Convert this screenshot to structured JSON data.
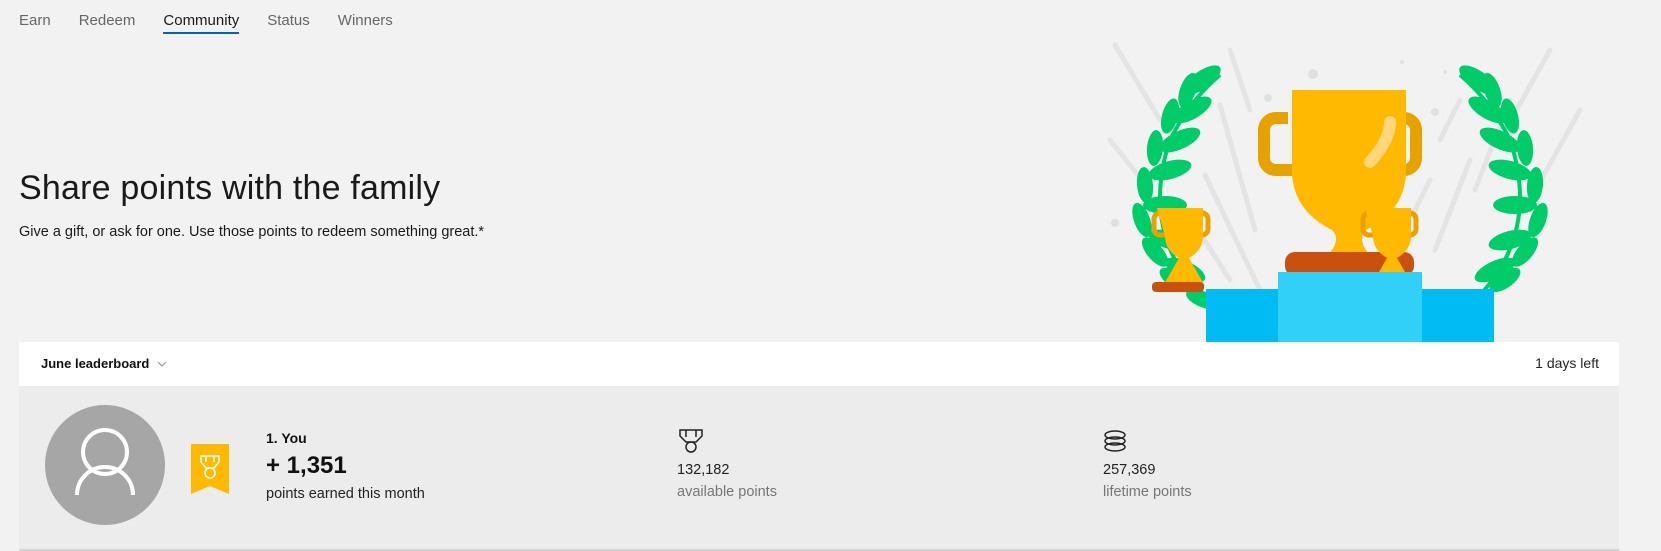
{
  "nav": {
    "tabs": [
      {
        "label": "Earn",
        "active": false
      },
      {
        "label": "Redeem",
        "active": false
      },
      {
        "label": "Community",
        "active": true
      },
      {
        "label": "Status",
        "active": false
      },
      {
        "label": "Winners",
        "active": false
      }
    ]
  },
  "hero": {
    "title": "Share points with the family",
    "subtitle": "Give a gift, or ask for one. Use those points to redeem something great.*",
    "illustration": "trophies-on-podium-with-laurels"
  },
  "leaderboard": {
    "selector_label": "June leaderboard",
    "selector_icon": "chevron-down-icon",
    "days_left": "1 days left",
    "entry": {
      "avatar_icon": "person-icon",
      "badge_icon": "medal-ribbon-icon",
      "rank_label": "1. You",
      "points_earned": "+ 1,351",
      "points_earned_label": "points earned this month",
      "available": {
        "icon": "medal-icon",
        "value": "132,182",
        "label": "available points"
      },
      "lifetime": {
        "icon": "coin-stack-icon",
        "value": "257,369",
        "label": "lifetime points"
      }
    }
  },
  "colors": {
    "accent": "#0067b8",
    "badge": "#ffb900",
    "trophy": "#ffb900",
    "laurel": "#00cc6a",
    "podium": "#00bcf2"
  }
}
